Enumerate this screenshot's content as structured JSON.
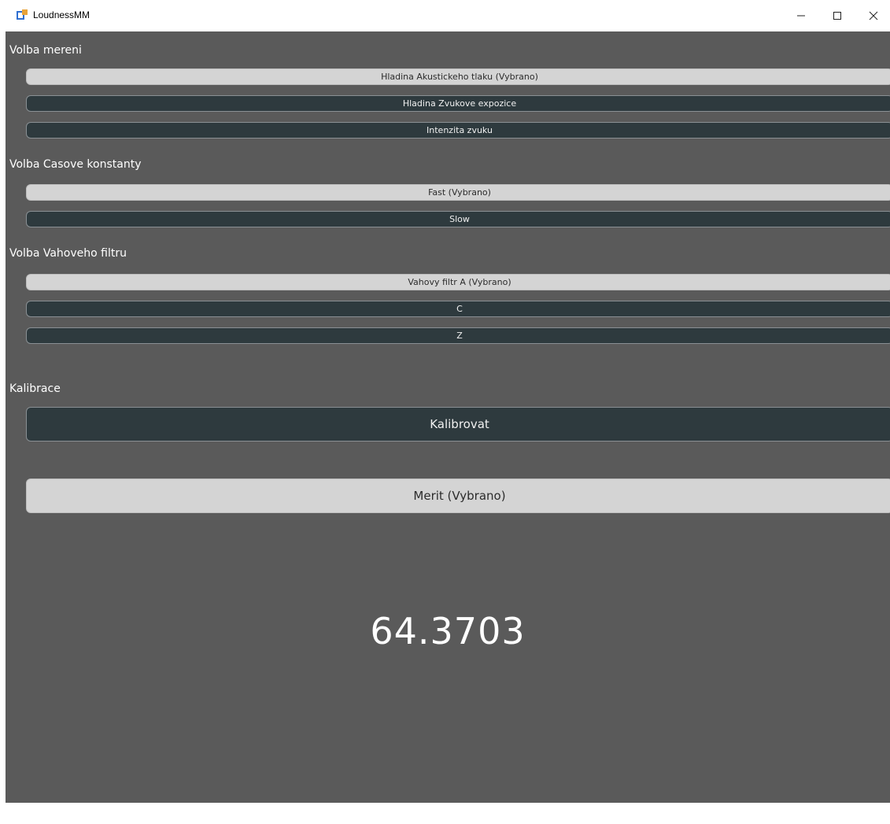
{
  "window": {
    "title": "LoudnessMM",
    "icon": "app-icon",
    "controls": {
      "minimize_glyph": "—",
      "maximize_glyph": "☐",
      "close_glyph": "✕"
    }
  },
  "sections": {
    "measurement": {
      "label": "Volba mereni",
      "options": [
        {
          "label": "Hladina Akustickeho tlaku (Vybrano)",
          "selected": true
        },
        {
          "label": "Hladina Zvukove expozice",
          "selected": false
        },
        {
          "label": "Intenzita zvuku",
          "selected": false
        }
      ]
    },
    "time_constant": {
      "label": "Volba Casove konstanty",
      "options": [
        {
          "label": "Fast (Vybrano)",
          "selected": true
        },
        {
          "label": "Slow",
          "selected": false
        }
      ]
    },
    "weighting_filter": {
      "label": "Volba Vahoveho filtru",
      "options": [
        {
          "label": "Vahovy filtr A (Vybrano)",
          "selected": true
        },
        {
          "label": "C",
          "selected": false
        },
        {
          "label": "Z",
          "selected": false
        }
      ]
    },
    "calibration": {
      "label": "Kalibrace",
      "button_label": "Kalibrovat"
    }
  },
  "measure_button": {
    "label": "Merit (Vybrano)",
    "selected": true
  },
  "reading": {
    "value": "64.3703"
  },
  "colors": {
    "background": "#5a5a5a",
    "selected_button": "#d4d4d4",
    "unselected_button": "#2e3a3e",
    "text_light": "#ffffff"
  }
}
